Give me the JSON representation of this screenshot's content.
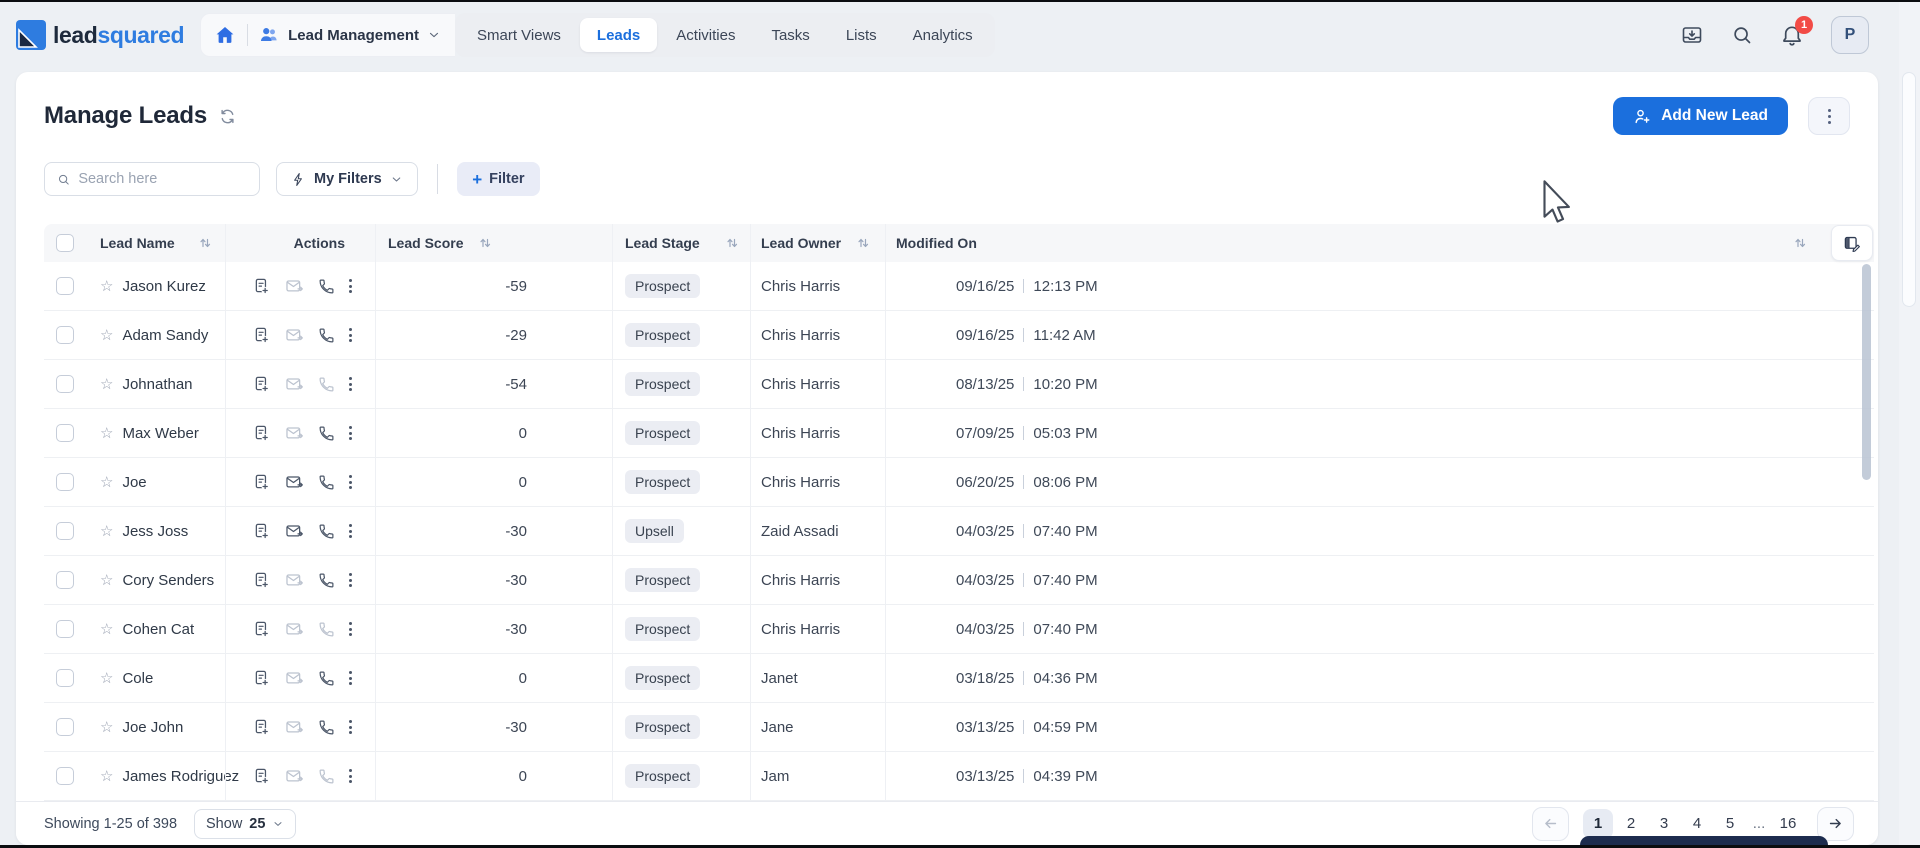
{
  "colors": {
    "primary_blue": "#1b6fdd",
    "notification_red": "#f24b46",
    "badge_bg": "#ebedf3",
    "toast_navy": "#1d2c4e"
  },
  "icons": {
    "star": "☆",
    "plus": "+"
  },
  "brand": {
    "word_dark": "lead",
    "word_blue": "squared"
  },
  "nav": {
    "module_label": "Lead Management",
    "tabs": [
      {
        "label": "Smart Views",
        "active": false
      },
      {
        "label": "Leads",
        "active": true
      },
      {
        "label": "Activities",
        "active": false
      },
      {
        "label": "Tasks",
        "active": false
      },
      {
        "label": "Lists",
        "active": false
      },
      {
        "label": "Analytics",
        "active": false
      }
    ],
    "notification_badge": "1",
    "avatar_initial": "P"
  },
  "page": {
    "title": "Manage Leads",
    "add_new_lead": "Add New Lead"
  },
  "filter_bar": {
    "search_placeholder": "Search here",
    "my_filters_label": "My Filters",
    "filter_plus": "+",
    "filter_label": "Filter"
  },
  "table": {
    "headers": {
      "lead_name": "Lead Name",
      "actions": "Actions",
      "lead_score": "Lead Score",
      "lead_stage": "Lead Stage",
      "lead_owner": "Lead Owner",
      "modified_on": "Modified On"
    },
    "rows": [
      {
        "name": "Jason Kurez",
        "score": "-59",
        "stage": "Prospect",
        "owner": "Chris Harris",
        "date": "09/16/25",
        "time": "12:13 PM",
        "mail_muted": true,
        "phone_muted": false
      },
      {
        "name": "Adam Sandy",
        "score": "-29",
        "stage": "Prospect",
        "owner": "Chris Harris",
        "date": "09/16/25",
        "time": "11:42 AM",
        "mail_muted": true,
        "phone_muted": false
      },
      {
        "name": "Johnathan",
        "score": "-54",
        "stage": "Prospect",
        "owner": "Chris Harris",
        "date": "08/13/25",
        "time": "10:20 PM",
        "mail_muted": true,
        "phone_muted": true
      },
      {
        "name": "Max Weber",
        "score": "0",
        "stage": "Prospect",
        "owner": "Chris Harris",
        "date": "07/09/25",
        "time": "05:03 PM",
        "mail_muted": true,
        "phone_muted": false
      },
      {
        "name": "Joe",
        "score": "0",
        "stage": "Prospect",
        "owner": "Chris Harris",
        "date": "06/20/25",
        "time": "08:06 PM",
        "mail_muted": false,
        "phone_muted": false
      },
      {
        "name": "Jess Joss",
        "score": "-30",
        "stage": "Upsell",
        "owner": "Zaid Assadi",
        "date": "04/03/25",
        "time": "07:40 PM",
        "mail_muted": false,
        "phone_muted": false
      },
      {
        "name": "Cory Senders",
        "score": "-30",
        "stage": "Prospect",
        "owner": "Chris Harris",
        "date": "04/03/25",
        "time": "07:40 PM",
        "mail_muted": true,
        "phone_muted": false
      },
      {
        "name": "Cohen Cat",
        "score": "-30",
        "stage": "Prospect",
        "owner": "Chris Harris",
        "date": "04/03/25",
        "time": "07:40 PM",
        "mail_muted": true,
        "phone_muted": true
      },
      {
        "name": "Cole",
        "score": "0",
        "stage": "Prospect",
        "owner": "Janet",
        "date": "03/18/25",
        "time": "04:36 PM",
        "mail_muted": true,
        "phone_muted": false
      },
      {
        "name": "Joe John",
        "score": "-30",
        "stage": "Prospect",
        "owner": "Jane",
        "date": "03/13/25",
        "time": "04:59 PM",
        "mail_muted": true,
        "phone_muted": false
      },
      {
        "name": "James Rodriguez",
        "score": "0",
        "stage": "Prospect",
        "owner": "Jam",
        "date": "03/13/25",
        "time": "04:39 PM",
        "mail_muted": true,
        "phone_muted": true
      }
    ]
  },
  "footer": {
    "showing_text": "Showing 1-25 of 398",
    "show_label": "Show",
    "show_value": "25",
    "pages": [
      "1",
      "2",
      "3",
      "4",
      "5",
      "...",
      "16"
    ],
    "active_page": "1"
  }
}
